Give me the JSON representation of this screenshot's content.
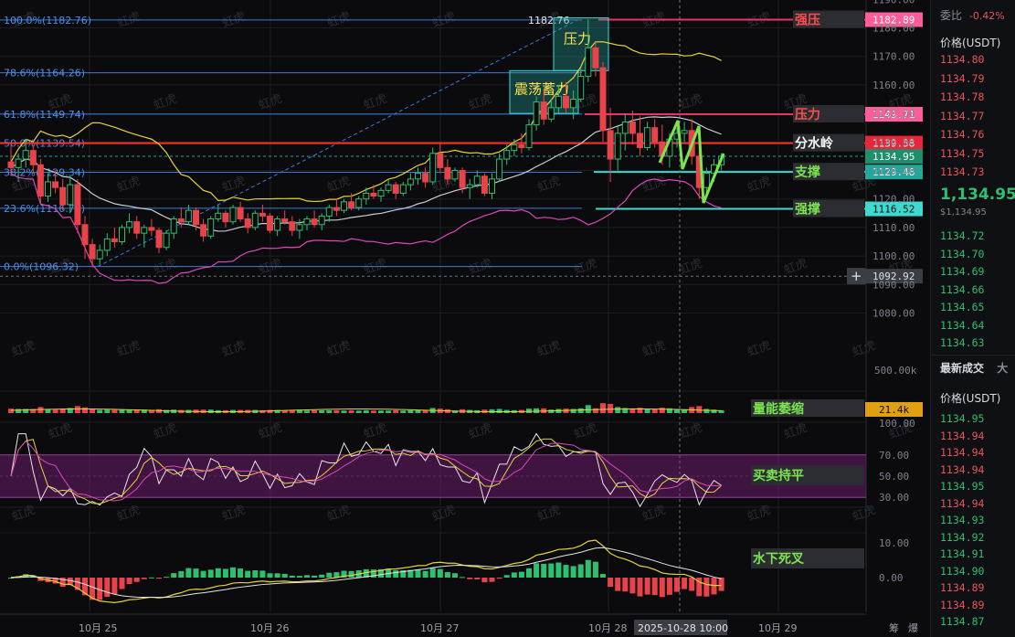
{
  "chart_data": {
    "type": "candlestick",
    "x_ticks": [
      "10月 25",
      "10月 26",
      "10月 27",
      "10月 28",
      "10月 29"
    ],
    "crosshair_time": "2025-10-28 10:00",
    "bottom_tools": [
      "筹",
      "爆"
    ],
    "watermark": "虹虎",
    "price_axis": {
      "ticks": [
        1190.0,
        1180.0,
        1170.0,
        1160.0,
        1150.0,
        1140.0,
        1130.0,
        1120.0,
        1110.0,
        1100.0,
        1090.0,
        1080.0
      ],
      "range": [
        1073,
        1191
      ]
    },
    "fibonacci": [
      {
        "label": "100.0%(1182.76)",
        "price": 1182.76
      },
      {
        "label": "78.6%(1164.26)",
        "price": 1164.26
      },
      {
        "label": "61.8%(1149.74)",
        "price": 1149.74
      },
      {
        "label": "50.0%(1139.54)",
        "price": 1139.54
      },
      {
        "label": "38.2%(1129.34)",
        "price": 1129.34
      },
      {
        "label": "23.6%(1116.72)",
        "price": 1116.72
      },
      {
        "label": "0.0%(1096.32)",
        "price": 1096.32
      }
    ],
    "high_label": "1182.76",
    "levels": [
      {
        "label": "强压",
        "price": 1182.89,
        "price_label": "1182.89",
        "color": "#e8326a",
        "badge": "#ff5c9a"
      },
      {
        "label": "压力",
        "price": 1149.71,
        "price_label": "1149.71",
        "color": "#e8326a",
        "badge": "#ff5c9a"
      },
      {
        "label": "分水岭",
        "price": 1139.58,
        "price_label": "1139.58",
        "color": "#ff2d2d",
        "badge": "#e8263a"
      },
      {
        "label": "支撑",
        "price": 1129.46,
        "price_label": "1129.46",
        "color": "#3fd9d0",
        "badge": "#26a69a"
      },
      {
        "label": "强撑",
        "price": 1116.52,
        "price_label": "1116.52",
        "color": "#3fd9d0",
        "badge": "#3fd9d0"
      }
    ],
    "current_price": {
      "price": 1134.95,
      "label": "1134.95"
    },
    "crosshair_price": {
      "price": 1092.92,
      "label": "1092.92"
    },
    "boxes": [
      {
        "label": "压力",
        "price_top": 1183.5,
        "price_bottom": 1165
      },
      {
        "label": "震荡蓄力",
        "price_top": 1165,
        "price_bottom": 1150
      }
    ],
    "candles": [
      [
        1133,
        1139,
        1128,
        1131
      ],
      [
        1131,
        1136,
        1126,
        1134
      ],
      [
        1134,
        1141,
        1131,
        1137
      ],
      [
        1137,
        1139,
        1129,
        1132
      ],
      [
        1132,
        1134,
        1118,
        1121
      ],
      [
        1121,
        1129,
        1119,
        1126
      ],
      [
        1126,
        1130,
        1122,
        1124
      ],
      [
        1124,
        1127,
        1116,
        1118
      ],
      [
        1118,
        1128,
        1115,
        1125
      ],
      [
        1125,
        1127,
        1108,
        1111
      ],
      [
        1111,
        1114,
        1099,
        1104
      ],
      [
        1104,
        1106,
        1096,
        1099
      ],
      [
        1099,
        1104,
        1097,
        1102
      ],
      [
        1102,
        1108,
        1100,
        1106
      ],
      [
        1106,
        1110,
        1103,
        1105
      ],
      [
        1105,
        1111,
        1104,
        1110
      ],
      [
        1110,
        1115,
        1108,
        1112
      ],
      [
        1112,
        1114,
        1106,
        1108
      ],
      [
        1108,
        1111,
        1103,
        1110
      ],
      [
        1110,
        1113,
        1107,
        1109
      ],
      [
        1109,
        1110,
        1101,
        1103
      ],
      [
        1103,
        1109,
        1102,
        1108
      ],
      [
        1108,
        1114,
        1106,
        1113
      ],
      [
        1113,
        1117,
        1110,
        1112
      ],
      [
        1112,
        1118,
        1111,
        1116
      ],
      [
        1116,
        1117,
        1109,
        1111
      ],
      [
        1111,
        1113,
        1105,
        1107
      ],
      [
        1107,
        1114,
        1106,
        1113
      ],
      [
        1113,
        1118,
        1112,
        1115
      ],
      [
        1115,
        1116,
        1110,
        1112
      ],
      [
        1112,
        1118,
        1111,
        1117
      ],
      [
        1117,
        1119,
        1112,
        1113
      ],
      [
        1113,
        1115,
        1108,
        1110
      ],
      [
        1110,
        1116,
        1109,
        1115
      ],
      [
        1115,
        1118,
        1112,
        1114
      ],
      [
        1114,
        1115,
        1108,
        1109
      ],
      [
        1109,
        1114,
        1107,
        1113
      ],
      [
        1113,
        1116,
        1111,
        1112
      ],
      [
        1112,
        1114,
        1107,
        1109
      ],
      [
        1109,
        1113,
        1106,
        1111
      ],
      [
        1111,
        1114,
        1109,
        1113
      ],
      [
        1113,
        1116,
        1110,
        1111
      ],
      [
        1111,
        1115,
        1109,
        1114
      ],
      [
        1114,
        1118,
        1112,
        1117
      ],
      [
        1117,
        1120,
        1114,
        1116
      ],
      [
        1116,
        1120,
        1115,
        1119
      ],
      [
        1119,
        1122,
        1116,
        1117
      ],
      [
        1117,
        1121,
        1116,
        1120
      ],
      [
        1120,
        1124,
        1118,
        1122
      ],
      [
        1122,
        1125,
        1120,
        1121
      ],
      [
        1121,
        1124,
        1119,
        1123
      ],
      [
        1123,
        1127,
        1122,
        1125
      ],
      [
        1125,
        1126,
        1120,
        1122
      ],
      [
        1122,
        1126,
        1121,
        1125
      ],
      [
        1125,
        1129,
        1123,
        1127
      ],
      [
        1127,
        1131,
        1125,
        1129
      ],
      [
        1129,
        1131,
        1124,
        1126
      ],
      [
        1126,
        1138,
        1125,
        1136
      ],
      [
        1136,
        1140,
        1129,
        1131
      ],
      [
        1131,
        1134,
        1125,
        1127
      ],
      [
        1127,
        1131,
        1126,
        1130
      ],
      [
        1130,
        1131,
        1122,
        1124
      ],
      [
        1124,
        1127,
        1120,
        1125
      ],
      [
        1125,
        1130,
        1124,
        1128
      ],
      [
        1128,
        1129,
        1121,
        1122
      ],
      [
        1122,
        1129,
        1120,
        1127
      ],
      [
        1127,
        1136,
        1126,
        1134
      ],
      [
        1134,
        1139,
        1132,
        1137
      ],
      [
        1137,
        1141,
        1135,
        1139
      ],
      [
        1139,
        1143,
        1136,
        1138
      ],
      [
        1138,
        1148,
        1137,
        1146
      ],
      [
        1146,
        1156,
        1144,
        1154
      ],
      [
        1154,
        1158,
        1146,
        1148
      ],
      [
        1148,
        1155,
        1147,
        1152
      ],
      [
        1152,
        1160,
        1150,
        1156
      ],
      [
        1156,
        1161,
        1150,
        1152
      ],
      [
        1152,
        1158,
        1148,
        1155
      ],
      [
        1155,
        1166,
        1154,
        1163
      ],
      [
        1163,
        1183,
        1161,
        1173
      ],
      [
        1173,
        1175,
        1163,
        1166
      ],
      [
        1166,
        1168,
        1140,
        1144
      ],
      [
        1144,
        1152,
        1126,
        1134
      ],
      [
        1134,
        1146,
        1130,
        1143
      ],
      [
        1143,
        1150,
        1137,
        1147
      ],
      [
        1147,
        1151,
        1139,
        1143
      ],
      [
        1143,
        1149,
        1135,
        1138
      ],
      [
        1138,
        1147,
        1137,
        1145
      ],
      [
        1145,
        1148,
        1138,
        1140
      ],
      [
        1140,
        1146,
        1132,
        1135
      ],
      [
        1135,
        1143,
        1131,
        1141
      ],
      [
        1141,
        1145,
        1138,
        1143
      ],
      [
        1143,
        1147,
        1140,
        1144
      ],
      [
        1144,
        1148,
        1132,
        1135
      ],
      [
        1135,
        1139,
        1120,
        1124
      ],
      [
        1124,
        1131,
        1121,
        1129
      ],
      [
        1129,
        1134,
        1126,
        1132
      ],
      [
        1132,
        1136,
        1130,
        1135
      ]
    ],
    "volume": {
      "axis_label": "500.00k",
      "current": "21.4k",
      "annotation": "量能萎缩"
    },
    "rsi": {
      "ticks": [
        "100.00",
        "70.00",
        "50.00",
        "30.00"
      ],
      "annotation": "买卖持平"
    },
    "macd": {
      "ticks": [
        "10.00",
        "0.00"
      ],
      "annotation": "水下死叉"
    }
  },
  "sidebar": {
    "commission_ratio_label": "委比",
    "commission_ratio_value": "-0.42%",
    "orderbook_header": "价格(USDT)",
    "asks": [
      "1134.80",
      "1134.79",
      "1134.78",
      "1134.77",
      "1134.76",
      "1134.75",
      "1134.73"
    ],
    "last_price": "1,134.95",
    "last_price_sub": "$1,134.95",
    "bids": [
      "1134.72",
      "1134.70",
      "1134.69",
      "1134.66",
      "1134.65",
      "1134.64",
      "1134.63"
    ],
    "trades_tab": "最新成交",
    "trades_tab2": "大",
    "trades_header": "价格(USDT)",
    "trades": [
      {
        "p": "1134.95",
        "c": "green"
      },
      {
        "p": "1134.94",
        "c": "red"
      },
      {
        "p": "1134.94",
        "c": "red"
      },
      {
        "p": "1134.94",
        "c": "red"
      },
      {
        "p": "1134.95",
        "c": "green"
      },
      {
        "p": "1134.94",
        "c": "red"
      },
      {
        "p": "1134.93",
        "c": "green"
      },
      {
        "p": "1134.92",
        "c": "green"
      },
      {
        "p": "1134.91",
        "c": "green"
      },
      {
        "p": "1134.90",
        "c": "green"
      },
      {
        "p": "1134.89",
        "c": "red"
      },
      {
        "p": "1134.89",
        "c": "red"
      },
      {
        "p": "1134.87",
        "c": "green"
      }
    ]
  }
}
